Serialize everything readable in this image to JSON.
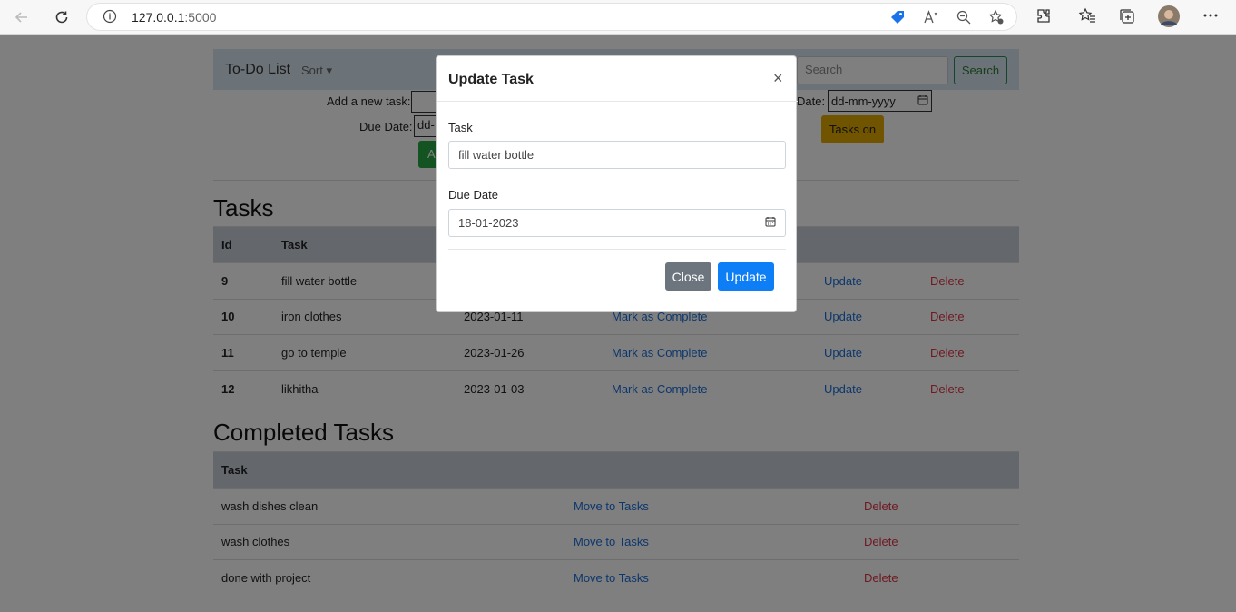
{
  "browser": {
    "url_host": "127.0.0.1",
    "url_port": ":5000"
  },
  "app": {
    "brand": "To-Do List",
    "sort_label": "Sort",
    "search_placeholder": "Search",
    "search_button": "Search",
    "add_task_label": "Add a new task:",
    "due_date_label": "Due Date:",
    "date_label_right": "Date:",
    "date_placeholder": "dd-mm-yyyy",
    "date_placeholder_partial": "dd-",
    "add_button_partial": "A",
    "tasks_on_button": "Tasks on"
  },
  "tasks": {
    "heading": "Tasks",
    "col_id": "Id",
    "col_task": "Task",
    "rows": [
      {
        "id": "9",
        "task": "fill water bottle",
        "date": "",
        "complete": "",
        "update": "Update",
        "delete": "Delete"
      },
      {
        "id": "10",
        "task": "iron clothes",
        "date": "2023-01-11",
        "complete": "Mark as Complete",
        "update": "Update",
        "delete": "Delete"
      },
      {
        "id": "11",
        "task": "go to temple",
        "date": "2023-01-26",
        "complete": "Mark as Complete",
        "update": "Update",
        "delete": "Delete"
      },
      {
        "id": "12",
        "task": "likhitha",
        "date": "2023-01-03",
        "complete": "Mark as Complete",
        "update": "Update",
        "delete": "Delete"
      }
    ]
  },
  "completed": {
    "heading": "Completed Tasks",
    "col_task": "Task",
    "rows": [
      {
        "task": "wash dishes clean",
        "move": "Move to Tasks",
        "delete": "Delete"
      },
      {
        "task": "wash clothes",
        "move": "Move to Tasks",
        "delete": "Delete"
      },
      {
        "task": "done with project",
        "move": "Move to Tasks",
        "delete": "Delete"
      }
    ]
  },
  "modal": {
    "title": "Update Task",
    "close_symbol": "×",
    "task_label": "Task",
    "task_value": "fill water bottle",
    "due_label": "Due Date",
    "due_value": "18-01-2023",
    "close_button": "Close",
    "update_button": "Update"
  }
}
